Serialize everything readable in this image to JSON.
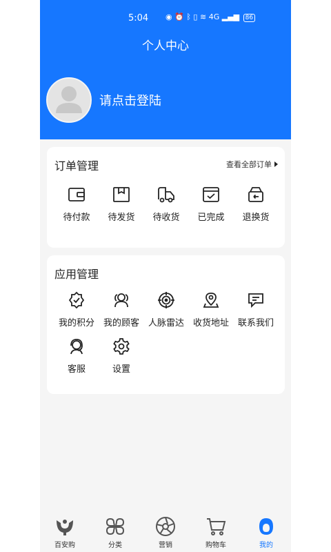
{
  "status_bar": {
    "time": "5:04",
    "network": "4G",
    "battery": "86"
  },
  "header": {
    "title": "个人中心",
    "login_prompt": "请点击登陆"
  },
  "orders": {
    "title": "订单管理",
    "view_all": "查看全部订单",
    "items": [
      {
        "label": "待付款",
        "icon": "wallet-icon"
      },
      {
        "label": "待发货",
        "icon": "package-icon"
      },
      {
        "label": "待收货",
        "icon": "delivery-truck-icon"
      },
      {
        "label": "已完成",
        "icon": "checked-box-icon"
      },
      {
        "label": "退换货",
        "icon": "return-box-icon"
      }
    ]
  },
  "apps": {
    "title": "应用管理",
    "items": [
      {
        "label": "我的积分",
        "icon": "points-badge-icon"
      },
      {
        "label": "我的顾客",
        "icon": "customers-icon"
      },
      {
        "label": "人脉雷达",
        "icon": "radar-icon"
      },
      {
        "label": "收货地址",
        "icon": "location-pin-icon"
      },
      {
        "label": "联系我们",
        "icon": "chat-icon"
      },
      {
        "label": "客服",
        "icon": "customer-service-icon"
      },
      {
        "label": "设置",
        "icon": "gear-icon"
      }
    ]
  },
  "tabbar": {
    "active_color": "#1677ff",
    "items": [
      {
        "label": "百安购",
        "icon": "home-logo-icon"
      },
      {
        "label": "分类",
        "icon": "category-icon"
      },
      {
        "label": "营销",
        "icon": "marketing-icon"
      },
      {
        "label": "购物车",
        "icon": "cart-icon"
      },
      {
        "label": "我的",
        "icon": "profile-icon"
      }
    ],
    "active_index": 4
  },
  "colors": {
    "primary": "#1677ff",
    "background": "#f5f5f5",
    "card": "#ffffff"
  }
}
